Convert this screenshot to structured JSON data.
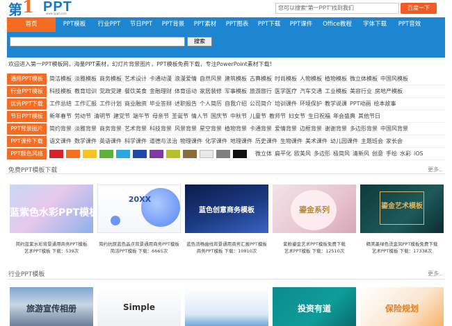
{
  "logo": {
    "main_left": "第",
    "main_right": "PPT",
    "digit": "1",
    "sub": "www.1ppt.com"
  },
  "search": {
    "placeholder": "您可以搜索“第一PPT”找到我们",
    "button": "百度一下",
    "inner_button": "搜索"
  },
  "nav": [
    "首页",
    "PPT模板",
    "行业PPT",
    "节日PPT",
    "PPT背景",
    "PPT素材",
    "PPT图表",
    "PPT下载",
    "PPT课件",
    "Office教程",
    "字体下载",
    "PPT音效"
  ],
  "welcome": "欢迎进入第一PPT模板网，海量PPT素材，幻灯片背景图片，PPT模板免费下载，专注PowerPoint素材下载！",
  "categories": [
    {
      "tag": "通用PPT模板",
      "links": [
        "简洁模板",
        "淡雅模板",
        "商务模板",
        "艺术设计",
        "卡通动漫",
        "浪漫爱情",
        "自然风景",
        "建筑模板",
        "古典模板",
        "时尚模板",
        "人物模板",
        "植物模板",
        "微立体模板",
        "中国风模板"
      ]
    },
    {
      "tag": "行业PPT模板",
      "links": [
        "科技模板",
        "教育培训",
        "党政党建",
        "餐饮美食",
        "金融理财",
        "体育运动",
        "家居装修",
        "军事模板",
        "旅游旅行",
        "医学医疗",
        "汽车交通",
        "工业模板",
        "美容行业",
        "房地产模板"
      ]
    },
    {
      "tag": "优秀PPT下载",
      "links": [
        "工作总结",
        "工作汇报",
        "工作计划",
        "商业融资",
        "毕业答辩",
        "述职报告",
        "个人简历",
        "自我介绍",
        "公司简介",
        "培训课件",
        "环境保护",
        "教学说课",
        "PPT动画",
        "绘本故事"
      ]
    },
    {
      "tag": "节日PPT模板",
      "links": [
        "新年春节",
        "劳动节",
        "清明节",
        "建党节",
        "端午节",
        "母亲节",
        "圣诞节",
        "情人节",
        "国庆节",
        "中秋节",
        "儿童节",
        "教师节",
        "妇女节",
        "生日祝福",
        "年会盛典",
        "其他节日"
      ]
    },
    {
      "tag": "PPT背景图片",
      "links": [
        "简约背景",
        "淡雅背景",
        "商务背景",
        "艺术背景",
        "科技背景",
        "风景背景",
        "星空背景",
        "植物背景",
        "卡通背景",
        "爱情背景",
        "边框背景",
        "谢谢背景",
        "多边形背景",
        "中国风背景"
      ]
    },
    {
      "tag": "PPT课件下载",
      "links": [
        "语文课件",
        "数学课件",
        "英语课件",
        "科学课件",
        "道德与法治",
        "物理课件",
        "化学课件",
        "地理课件",
        "历史课件",
        "生物课件",
        "美术课件",
        "幼儿园课件",
        "主题班会",
        "家长会"
      ]
    },
    {
      "tag": "PPT颜色风格",
      "colors": [
        "#d5232a",
        "#f37020",
        "#f7c41f",
        "#5fb03a",
        "#2ba7df",
        "#1f48a8",
        "#7f3a9e",
        "#b7c02a",
        "#8a6d3b",
        "#e8e8e8",
        "#7f7f7f",
        "#111111"
      ],
      "links": [
        "微立体",
        "扁平化",
        "欧美风",
        "多边形",
        "极简风",
        "清新风",
        "创意",
        "手绘",
        "水彩",
        "iOS"
      ]
    }
  ],
  "free_section": {
    "title": "免费PPT模板下载",
    "more": "更多..",
    "cards": [
      {
        "title": "蓝紫色水彩PPT模板",
        "caption": "简约蓝紫水彩背景通用商务PPT模板",
        "category": "艺术PPT模板",
        "downloads": "下载：539次"
      },
      {
        "title": "20XX",
        "caption": "简约抗原蓝色晶点背景通用商务PPT模板",
        "category": "简洁PPT模板",
        "downloads": "下载：6665次"
      },
      {
        "title": "蓝色创意商务模板",
        "caption": "蓝色流畅曲线背景通用商务汇报PPT模板",
        "category": "商务PPT模板",
        "downloads": "下载：10810次"
      },
      {
        "title": "鎏金系列",
        "caption": "紫粉鎏金艺术PPT模板免费下载",
        "category": "艺术PPT模板",
        "downloads": "下载：12510次"
      },
      {
        "title": "鎏金艺术模板",
        "caption": "精美墨绿色烫金风PPT模板免费下载",
        "category": "艺术PPT模板",
        "downloads": "下载：17338次"
      }
    ]
  },
  "industry_section": {
    "title": "行业PPT模板",
    "more": "更多..",
    "cards": [
      {
        "title": "旅游宣传相册"
      },
      {
        "title": "Simple"
      },
      {
        "title": ""
      },
      {
        "title": "投资有道"
      },
      {
        "title": "保险规划"
      }
    ]
  }
}
